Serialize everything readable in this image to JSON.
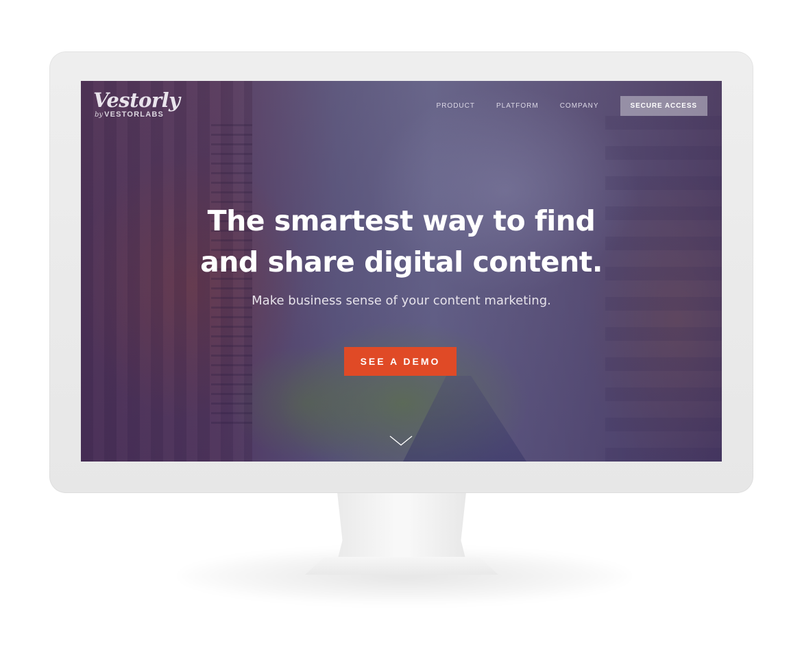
{
  "brand": {
    "logo_word": "Vestorly",
    "logo_by": "by",
    "logo_company": "VESTORLABS"
  },
  "nav": {
    "items": [
      {
        "label": "PRODUCT"
      },
      {
        "label": "PLATFORM"
      },
      {
        "label": "COMPANY"
      }
    ],
    "cta_label": "SECURE ACCESS"
  },
  "hero": {
    "title_line1": "The smartest way to find",
    "title_line2": "and share digital content.",
    "subtitle": "Make business sense of your content marketing.",
    "button_label": "SEE A DEMO",
    "scroll_icon": "chevron-down-icon"
  },
  "colors": {
    "accent": "#e04a26",
    "monitor_bezel": "#eeeeee",
    "screen_tint": "#3a3370"
  }
}
